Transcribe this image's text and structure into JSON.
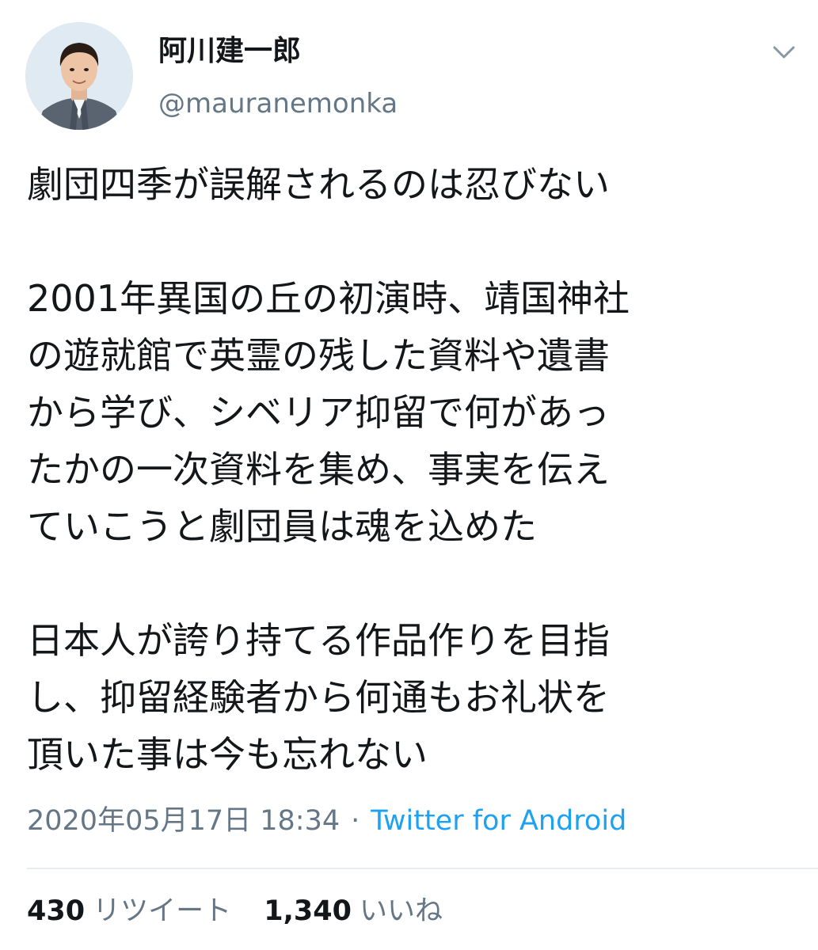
{
  "author": {
    "display_name": "阿川建一郎",
    "handle": "@mauranemonka",
    "avatar": "profile-photo"
  },
  "menu": {
    "icon": "chevron-down-icon"
  },
  "tweet": {
    "paragraphs": [
      [
        "劇団四季が誤解されるのは忍びない"
      ],
      [
        "2001年異国の丘の初演時、靖国神社",
        "の遊就館で英霊の残した資料や遺書",
        "から学び、シベリア抑留で何があっ",
        "たかの一次資料を集め、事実を伝え",
        "ていこうと劇団員は魂を込めた"
      ],
      [
        "日本人が誇り持てる作品作りを目指",
        "し、抑留経験者から何通もお礼状を",
        "頂いた事は今も忘れない"
      ]
    ],
    "timestamp": "2020年05月17日 18:34",
    "separator": "·",
    "source": "Twitter for Android"
  },
  "stats": {
    "retweets_count": "430",
    "retweets_label": "リツイート",
    "likes_count": "1,340",
    "likes_label": "いいね"
  },
  "colors": {
    "text": "#14171a",
    "secondary": "#657786",
    "link": "#1da1f2",
    "divider": "#e6ecf0"
  }
}
